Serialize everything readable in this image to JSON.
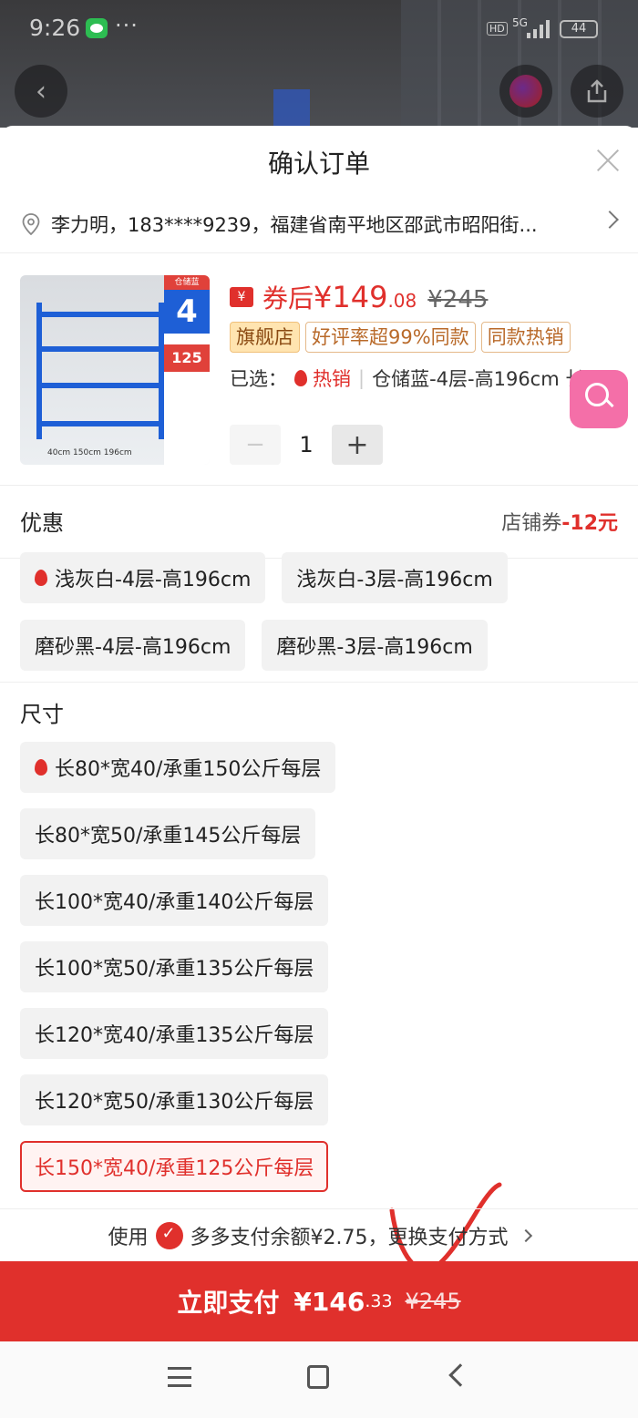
{
  "status_bar": {
    "time": "9:26",
    "dots": "···",
    "hd": "HD",
    "network": "5G",
    "battery": "44"
  },
  "sheet": {
    "title": "确认订单"
  },
  "address": {
    "text": "李力明，183****9239，福建省南平地区邵武市昭阳街..."
  },
  "product": {
    "image_tag_top": "仓储蓝",
    "image_tag_layers": "4",
    "image_tag_load": "125",
    "image_dims": "40cm 150cm 196cm",
    "coupon_icon": "¥",
    "price_label": "券后",
    "price_main": "¥149",
    "price_decimal": ".08",
    "price_old": "¥245",
    "badges": [
      "旗舰店",
      "好评率超99%同款",
      "同款热销"
    ],
    "selected_label": "已选：",
    "selected_hot": "热销",
    "selected_value": "仓储蓝-4层-高196cm 长..."
  },
  "quantity": {
    "minus": "−",
    "value": "1",
    "plus": "+"
  },
  "promo": {
    "label": "优惠",
    "value_prefix": "店铺券",
    "value_amount": "-12元"
  },
  "colors": [
    {
      "label": "浅灰白-4层-高196cm",
      "hot": true
    },
    {
      "label": "浅灰白-3层-高196cm",
      "hot": false
    },
    {
      "label": "磨砂黑-4层-高196cm",
      "hot": false
    },
    {
      "label": "磨砂黑-3层-高196cm",
      "hot": false
    }
  ],
  "size": {
    "title": "尺寸",
    "options": [
      {
        "label": "长80*宽40/承重150公斤每层",
        "hot": true,
        "selected": false
      },
      {
        "label": "长80*宽50/承重145公斤每层",
        "hot": false,
        "selected": false
      },
      {
        "label": "长100*宽40/承重140公斤每层",
        "hot": false,
        "selected": false
      },
      {
        "label": "长100*宽50/承重135公斤每层",
        "hot": false,
        "selected": false
      },
      {
        "label": "长120*宽40/承重135公斤每层",
        "hot": false,
        "selected": false
      },
      {
        "label": "长120*宽50/承重130公斤每层",
        "hot": false,
        "selected": false
      },
      {
        "label": "长150*宽40/承重125公斤每层",
        "hot": false,
        "selected": true
      }
    ]
  },
  "payment": {
    "prefix": "使用",
    "method": "多多支付余额¥2.75，更换支付方式"
  },
  "pay_button": {
    "label": "立即支付",
    "price_main": "¥146",
    "price_decimal": ".33",
    "price_old": "¥245"
  },
  "colors_theme": {
    "accent": "#e0302c",
    "zoom_button": "#f46fa8"
  }
}
